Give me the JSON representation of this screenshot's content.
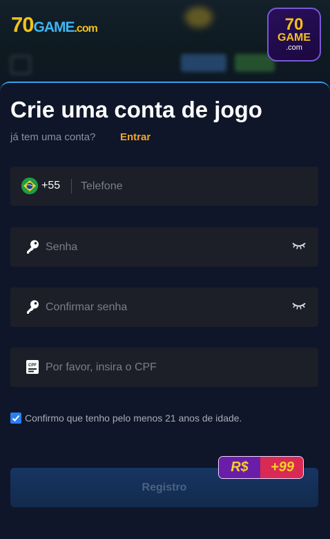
{
  "brand": {
    "number": "70",
    "game": "GAME",
    "dotcom": ".com"
  },
  "form": {
    "title": "Crie uma conta de jogo",
    "have_account": "já tem uma conta?",
    "login_label": "Entrar",
    "phone": {
      "country_code": "+55",
      "placeholder": "Telefone",
      "value": ""
    },
    "password": {
      "placeholder": "Senha",
      "value": ""
    },
    "confirm_password": {
      "placeholder": "Confirmar senha",
      "value": ""
    },
    "cpf": {
      "placeholder": "Por favor, insira o CPF",
      "value": ""
    },
    "age_checkbox": {
      "checked": true,
      "label": "Confirmo que tenho pelo menos 21 anos de idade."
    },
    "register_label": "Registro",
    "bonus": {
      "currency": "R$",
      "amount": "+99"
    }
  },
  "icons": {
    "flag": "brazil-flag-icon",
    "password": "key-icon",
    "visibility": "eye-closed-icon",
    "cpf": "cpf-card-icon",
    "check": "checkmark-icon"
  },
  "colors": {
    "accent": "#f2a52a",
    "checkbox": "#2c7ef0",
    "panel_border": "#3aa0e8",
    "register_button": "#173563",
    "badge_left": "#6a1ea8",
    "badge_right": "#d82a52"
  }
}
